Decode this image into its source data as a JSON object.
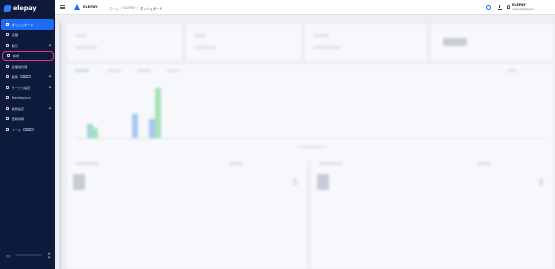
{
  "brand": {
    "name": "elepay"
  },
  "sidebar": {
    "items": [
      {
        "label": "ダッシュボード",
        "icon": "dashboard-icon",
        "active": true,
        "chevron": false,
        "badge": ""
      },
      {
        "label": "店舗",
        "icon": "store-icon",
        "active": false,
        "chevron": false,
        "badge": ""
      },
      {
        "label": "取引",
        "icon": "transaction-icon",
        "active": false,
        "chevron": true,
        "badge": ""
      },
      {
        "label": "請求",
        "icon": "invoice-icon",
        "active": false,
        "chevron": false,
        "badge": "",
        "highlighted": true
      },
      {
        "label": "従業員管理",
        "icon": "staff-icon",
        "active": false,
        "chevron": false,
        "badge": ""
      },
      {
        "label": "顧客",
        "icon": "customer-icon",
        "active": false,
        "chevron": true,
        "badge": "BETA"
      },
      {
        "label": "サービス設定",
        "icon": "service-settings-icon",
        "active": false,
        "chevron": true,
        "badge": ""
      },
      {
        "label": "Marketplace",
        "icon": "marketplace-icon",
        "active": false,
        "chevron": false,
        "badge": ""
      },
      {
        "label": "開発設定",
        "icon": "developer-icon",
        "active": false,
        "chevron": true,
        "badge": ""
      },
      {
        "label": "登録情報",
        "icon": "registration-icon",
        "active": false,
        "chevron": false,
        "badge": ""
      },
      {
        "label": "ツール",
        "icon": "tool-icon",
        "active": false,
        "chevron": false,
        "badge": "BETA"
      }
    ],
    "footer_label": "環境"
  },
  "header": {
    "org_name": "ELEPAY",
    "breadcrumbs": [
      "ホーム",
      "ELEPAY",
      "ダッシュボード"
    ],
    "user_name": "ELEPAY",
    "user_email": "support@elepay.io"
  },
  "colors": {
    "sidebar_bg": "#0d1a3c",
    "accent": "#1d6cf5",
    "highlight_ring": "#e4398a"
  }
}
